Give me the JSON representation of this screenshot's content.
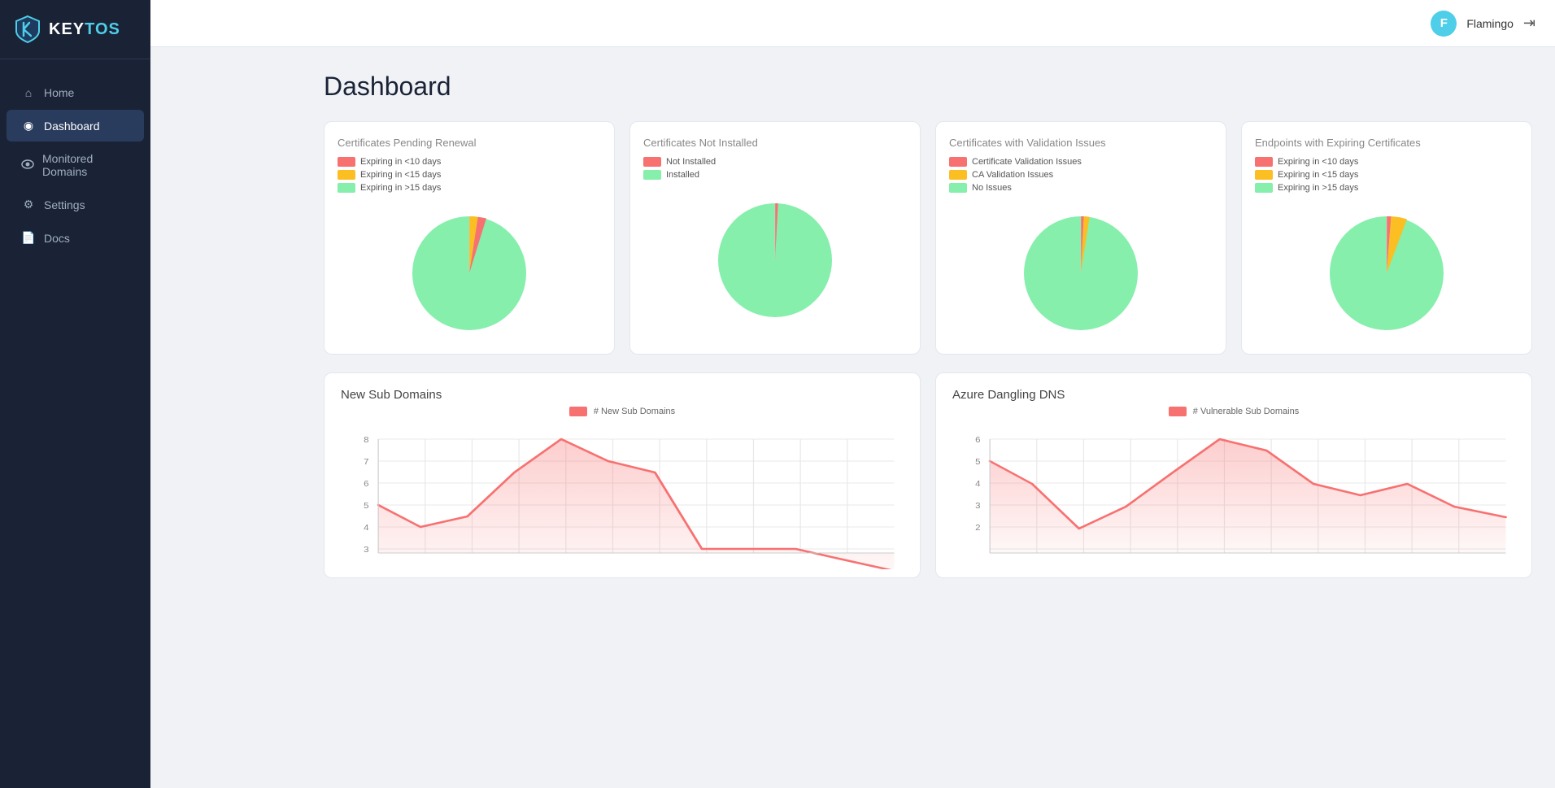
{
  "sidebar": {
    "logo_key": "KEY",
    "logo_tos": "TOS",
    "nav_items": [
      {
        "id": "home",
        "label": "Home",
        "icon": "⌂",
        "active": false
      },
      {
        "id": "dashboard",
        "label": "Dashboard",
        "icon": "◉",
        "active": true
      },
      {
        "id": "monitored-domains",
        "label": "Monitored Domains",
        "icon": "👁",
        "active": false
      },
      {
        "id": "settings",
        "label": "Settings",
        "icon": "⚙",
        "active": false
      },
      {
        "id": "docs",
        "label": "Docs",
        "icon": "📄",
        "active": false
      }
    ]
  },
  "topbar": {
    "user_initial": "F",
    "user_name": "Flamingo",
    "logout_icon": "logout"
  },
  "page": {
    "title": "Dashboard"
  },
  "pie_charts": [
    {
      "id": "pending-renewal",
      "title": "Certificates Pending Renewal",
      "legend": [
        {
          "label": "Expiring in <10 days",
          "color": "#f87171"
        },
        {
          "label": "Expiring in <15 days",
          "color": "#fbbf24"
        },
        {
          "label": "Expiring in >15 days",
          "color": "#86efac"
        }
      ],
      "slices": [
        {
          "color": "#f87171",
          "start": 0,
          "end": 3
        },
        {
          "color": "#fbbf24",
          "start": 3,
          "end": 10
        },
        {
          "color": "#86efac",
          "start": 10,
          "end": 360
        }
      ]
    },
    {
      "id": "not-installed",
      "title": "Certificates Not Installed",
      "legend": [
        {
          "label": "Not Installed",
          "color": "#f87171"
        },
        {
          "label": "Installed",
          "color": "#86efac"
        }
      ],
      "slices": [
        {
          "color": "#f87171",
          "start": 0,
          "end": 4
        },
        {
          "color": "#86efac",
          "start": 4,
          "end": 360
        }
      ]
    },
    {
      "id": "validation-issues",
      "title": "Certificates with Validation Issues",
      "legend": [
        {
          "label": "Certificate Validation Issues",
          "color": "#f87171"
        },
        {
          "label": "CA Validation Issues",
          "color": "#fbbf24"
        },
        {
          "label": "No Issues",
          "color": "#86efac"
        }
      ],
      "slices": [
        {
          "color": "#f87171",
          "start": 0,
          "end": 3
        },
        {
          "color": "#fbbf24",
          "start": 3,
          "end": 5
        },
        {
          "color": "#86efac",
          "start": 5,
          "end": 360
        }
      ]
    },
    {
      "id": "expiring-endpoints",
      "title": "Endpoints with Expiring Certificates",
      "legend": [
        {
          "label": "Expiring in <10 days",
          "color": "#f87171"
        },
        {
          "label": "Expiring in <15 days",
          "color": "#fbbf24"
        },
        {
          "label": "Expiring in >15 days",
          "color": "#86efac"
        }
      ],
      "slices": [
        {
          "color": "#f87171",
          "start": 0,
          "end": 4
        },
        {
          "color": "#fbbf24",
          "start": 4,
          "end": 12
        },
        {
          "color": "#86efac",
          "start": 12,
          "end": 360
        }
      ]
    }
  ],
  "line_charts": [
    {
      "id": "new-subdomains",
      "title": "New Sub Domains",
      "legend_label": "# New Sub Domains",
      "color": "#f87171",
      "fill": "rgba(248,113,113,0.2)",
      "y_max": 8,
      "y_min": 2,
      "data_points": [
        5,
        3.5,
        4.5,
        6.5,
        8,
        7,
        6.5,
        3,
        3,
        3,
        2.5,
        2
      ]
    },
    {
      "id": "azure-dangling-dns",
      "title": "Azure Dangling DNS",
      "legend_label": "# Vulnerable Sub Domains",
      "color": "#f87171",
      "fill": "rgba(248,113,113,0.2)",
      "y_max": 6,
      "y_min": 2,
      "data_points": [
        5,
        4,
        2,
        3,
        4.5,
        6,
        5.5,
        4,
        3.5,
        4,
        3,
        2.5
      ]
    }
  ]
}
